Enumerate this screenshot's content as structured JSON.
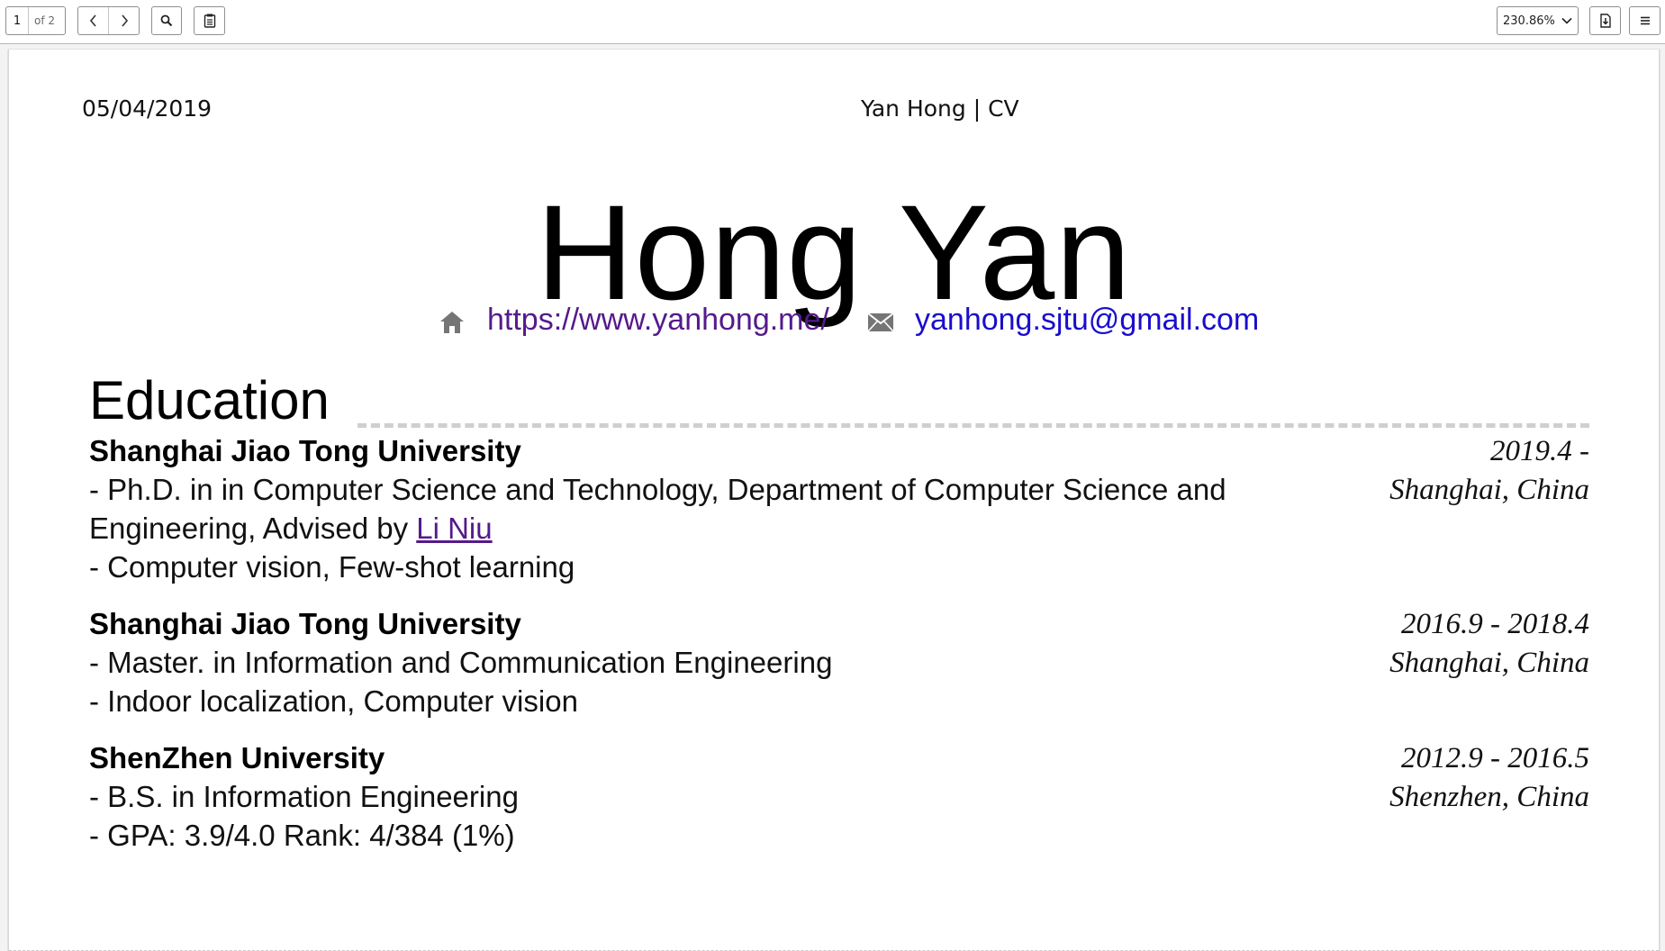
{
  "toolbar": {
    "page_current": "1",
    "page_of": "of 2",
    "zoom": "230.86%",
    "icons": {
      "prev": "chevron-left-icon",
      "next": "chevron-right-icon",
      "search": "search-icon",
      "notes": "notes-icon",
      "zoom_dropdown": "chevron-down-icon",
      "download": "download-icon",
      "menu": "hamburger-menu-icon"
    }
  },
  "document": {
    "header_date": "05/04/2019",
    "header_title": "Yan Hong | CV",
    "name": "Hong Yan",
    "contact": {
      "website_icon": "home-icon",
      "website": "https://www.yanhong.me/",
      "email_icon": "envelope-icon",
      "email": "yanhong.sjtu@gmail.com"
    },
    "sections": [
      {
        "title": "Education",
        "entries": [
          {
            "institution": "Shanghai Jiao Tong University",
            "date": "2019.4 -",
            "location": "Shanghai, China",
            "line1": "- Ph.D. in in Computer Science and Technology, Department of Computer Science and",
            "line2_prefix": "Engineering, Advised by ",
            "advisor": "Li Niu",
            "line3": "- Computer vision, Few-shot learning"
          },
          {
            "institution": "Shanghai Jiao Tong University",
            "date": "2016.9 - 2018.4",
            "location": "Shanghai, China",
            "line1": "- Master. in Information and Communication Engineering",
            "line2": "- Indoor localization, Computer vision"
          },
          {
            "institution": "ShenZhen University",
            "date": "2012.9 - 2016.5",
            "location": "Shenzhen, China",
            "line1": "- B.S. in Information Engineering",
            "line2": "- GPA: 3.9/4.0 Rank: 4/384 (1%)"
          }
        ]
      }
    ]
  },
  "colors": {
    "visited_link": "#551a8b",
    "link": "#1a0dcc",
    "icon_gray": "#757575",
    "section_rule": "#cfcfcf"
  }
}
